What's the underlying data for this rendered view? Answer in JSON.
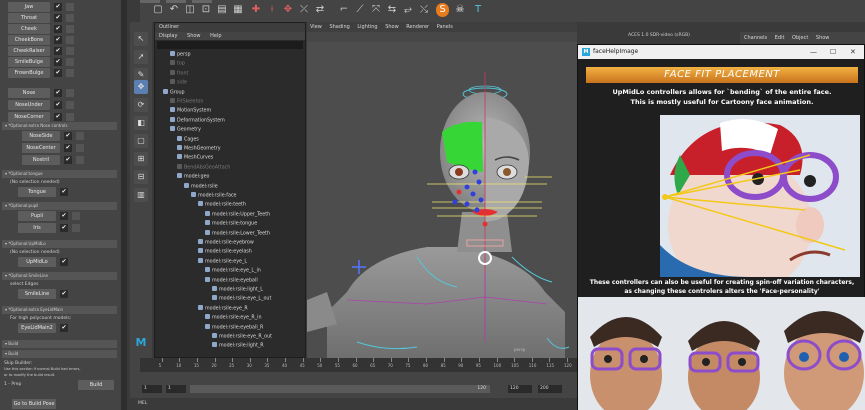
{
  "rig_panel": {
    "top_buttons": [
      {
        "label": "Jaw",
        "checked": true
      },
      {
        "label": "Throat",
        "checked": true
      },
      {
        "label": "Cheek",
        "checked": true
      },
      {
        "label": "CheekBone",
        "checked": true
      },
      {
        "label": "CheekRaiser",
        "checked": true
      },
      {
        "label": "SmileBulge",
        "checked": true
      },
      {
        "label": "FrownBulge",
        "checked": true
      }
    ],
    "mid_buttons": [
      {
        "label": "Nose",
        "checked": true
      },
      {
        "label": "NoseUnder",
        "checked": true
      },
      {
        "label": "NoseCorner",
        "checked": true
      }
    ],
    "section_nose": "*Optional:extra Nose controls",
    "nose_buttons": [
      {
        "label": "NoseSide",
        "checked": true
      },
      {
        "label": "NoseCenter",
        "checked": true
      },
      {
        "label": "Nostril",
        "checked": true
      }
    ],
    "section_tongue": "*Optional:tongue",
    "tongue_note": "(No selection needed)",
    "tongue_button": "Tongue",
    "section_pupil": "*Optional:pupil",
    "pupil_buttons": [
      {
        "label": "Pupil",
        "checked": true
      },
      {
        "label": "Iris",
        "checked": true
      }
    ],
    "section_upmidlo": "*Optional:UpMidLo",
    "upmidlo_note": "(No selection needed)",
    "upmidlo_button": "UpMidLo",
    "section_smileline": "*Optional:SmileLine",
    "smileline_note": "select Edges",
    "smileline_button": "SmileLine",
    "section_eyelidmain": "*Optional:extra EyeLidMain",
    "eyelid_note": "For high polycount models:",
    "eyelid_button": "EyeLidMain2",
    "build_sections": [
      "Build",
      "Build"
    ],
    "skip_title": "Skip Builder:",
    "skip_note_1": "Use this section if normal Build had errors,",
    "skip_note_2": "or to modify the build result.",
    "prep_label": "1 - Prep",
    "build_button": "Build",
    "pose_button": "Go to Build Pose"
  },
  "outliner": {
    "title": "Outliner",
    "menu": [
      "Display",
      "Show",
      "Help"
    ],
    "nodes": [
      {
        "label": "persp",
        "indent": 1,
        "dim": false
      },
      {
        "label": "top",
        "indent": 1,
        "dim": true
      },
      {
        "label": "front",
        "indent": 1,
        "dim": true
      },
      {
        "label": "side",
        "indent": 1,
        "dim": true
      },
      {
        "label": "Group",
        "indent": 0,
        "dim": false
      },
      {
        "label": "FitSkeleton",
        "indent": 1,
        "dim": true
      },
      {
        "label": "MotionSystem",
        "indent": 1,
        "dim": false
      },
      {
        "label": "DeformationSystem",
        "indent": 1,
        "dim": false
      },
      {
        "label": "Geometry",
        "indent": 1,
        "dim": false
      },
      {
        "label": "Cages",
        "indent": 2,
        "dim": false
      },
      {
        "label": "MeshGeometry",
        "indent": 2,
        "dim": false
      },
      {
        "label": "MeshCurves",
        "indent": 2,
        "dim": false
      },
      {
        "label": "BendAbsGeoAttach",
        "indent": 2,
        "dim": true
      },
      {
        "label": "model:geo",
        "indent": 2,
        "dim": false
      },
      {
        "label": "model:rsile",
        "indent": 3,
        "dim": false
      },
      {
        "label": "model:rsile:face",
        "indent": 4,
        "dim": false
      },
      {
        "label": "model:rsile:teeth",
        "indent": 5,
        "dim": false
      },
      {
        "label": "model:rsile:Upper_Teeth",
        "indent": 6,
        "dim": false
      },
      {
        "label": "model:rsile:tongue",
        "indent": 6,
        "dim": false
      },
      {
        "label": "model:rsile:Lower_Teeth",
        "indent": 6,
        "dim": false
      },
      {
        "label": "model:rsile:eyebrow",
        "indent": 5,
        "dim": false
      },
      {
        "label": "model:rsile:eyelash",
        "indent": 5,
        "dim": false
      },
      {
        "label": "model:rsile:eye_L",
        "indent": 5,
        "dim": false
      },
      {
        "label": "model:rsile:eye_L_in",
        "indent": 6,
        "dim": false
      },
      {
        "label": "model:rsile:eyeball",
        "indent": 6,
        "dim": false
      },
      {
        "label": "model:rsile:light_L",
        "indent": 7,
        "dim": false
      },
      {
        "label": "model:rsile:eye_L_out",
        "indent": 7,
        "dim": false
      },
      {
        "label": "model:rsile:eye_R",
        "indent": 5,
        "dim": false
      },
      {
        "label": "model:rsile:eye_R_in",
        "indent": 6,
        "dim": false
      },
      {
        "label": "model:rsile:eyeball_R",
        "indent": 6,
        "dim": false
      },
      {
        "label": "model:rsile:eye_R_out",
        "indent": 7,
        "dim": false
      },
      {
        "label": "model:rsile:light_R",
        "indent": 7,
        "dim": false
      }
    ]
  },
  "viewport": {
    "menu": [
      "View",
      "Shading",
      "Lighting",
      "Show",
      "Renderer",
      "Panels"
    ],
    "camera": "persp"
  },
  "right_panel": {
    "menu": [
      "Channels",
      "Edit",
      "Object",
      "Show"
    ],
    "colorspace": "ACES 1.0 SDR-video (sRGB)"
  },
  "help_window": {
    "title": "faceHelpImage",
    "heading": "FACE FIT PLACEMENT",
    "line1": "UpMidLo controllers allows for `bending` of the entire face.",
    "line2": "This is mostly useful for Cartoony face animation.",
    "line3": "These controllers can also be useful for creating spin-off variation characters,",
    "line4": "as changing these controlers alters the 'Face-personality'"
  },
  "timeline": {
    "ticks": [
      "5",
      "10",
      "15",
      "20",
      "25",
      "30",
      "35",
      "40",
      "45",
      "50",
      "55",
      "60",
      "65",
      "70",
      "75",
      "80",
      "85",
      "90",
      "95",
      "100",
      "105",
      "110",
      "115",
      "120"
    ],
    "start": "1",
    "start2": "1",
    "range_label": "120",
    "end": "120",
    "end2": "200",
    "mel_label": "MEL"
  },
  "colors": {
    "accent": "#f0a63a",
    "selection_green": "#37d637",
    "control_yellow": "#f2e86a",
    "control_blue": "#2f3fe0",
    "control_red": "#e53030",
    "rig_cyan": "#54c7d9"
  }
}
